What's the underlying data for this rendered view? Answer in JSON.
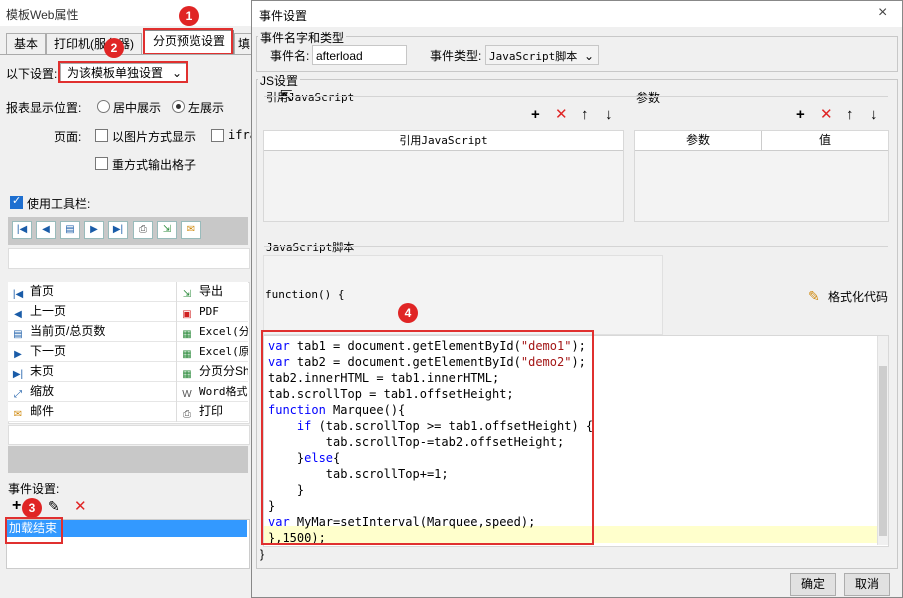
{
  "left": {
    "title": "模板Web属性",
    "tabs": [
      "基本",
      "打印机(服务器)",
      "分页预览设置",
      "填"
    ],
    "setting_label": "以下设置:",
    "setting_value": "为该模板单独设置",
    "display_label": "报表显示位置:",
    "radio_center": "居中展示",
    "radio_left": "左展示",
    "page_label": "页面:",
    "opt_image": "以图片方式显示",
    "opt_iframe": "ifra",
    "opt_redirect": "重方式输出格子",
    "use_toolbar": "使用工具栏:",
    "toolbar_grid": [
      [
        "首页",
        "导出"
      ],
      [
        "上一页",
        "PDF"
      ],
      [
        "当前页/总页数",
        "Excel(分"
      ],
      [
        "下一页",
        "Excel(原"
      ],
      [
        "末页",
        "分页分Sh"
      ],
      [
        "缩放",
        "Word格式"
      ],
      [
        "邮件",
        "打印"
      ]
    ],
    "event_label": "事件设置:",
    "event_item": "加载结束"
  },
  "badges": [
    "1",
    "2",
    "3",
    "4"
  ],
  "dialog": {
    "title": "事件设置",
    "close": "×",
    "name_type_group": "事件名字和类型",
    "event_name_label": "事件名:",
    "event_name_value": "afterload",
    "event_type_label": "事件类型:",
    "event_type_value": "JavaScript脚本",
    "js_group": "JS设置",
    "ref_js_label": "引用JavaScript",
    "params_label": "参数",
    "ref_js_header": "引用JavaScript",
    "param_header": "参数",
    "value_header": "值",
    "script_label": "JavaScript脚本",
    "function_header": "function() {",
    "format_code": "格式化代码",
    "closing_brace": "}",
    "ok": "确定",
    "cancel": "取消",
    "code_lines": [
      "var tab1 = document.getElementById(\"demo1\");",
      "var tab2 = document.getElementById(\"demo2\");",
      "tab2.innerHTML = tab1.innerHTML;",
      "tab.scrollTop = tab1.offsetHeight;",
      "function Marquee(){",
      "    if (tab.scrollTop >= tab1.offsetHeight) {",
      "        tab.scrollTop-=tab2.offsetHeight;",
      "    }else{",
      "        tab.scrollTop+=1;",
      "    }",
      "}",
      "var MyMar=setInterval(Marquee,speed);",
      "},1500);"
    ]
  },
  "colors": {
    "accent": "#1e6fd0",
    "annotation": "#e0302f",
    "selection": "#3399ff",
    "highlight_line": "#ffffcc"
  }
}
